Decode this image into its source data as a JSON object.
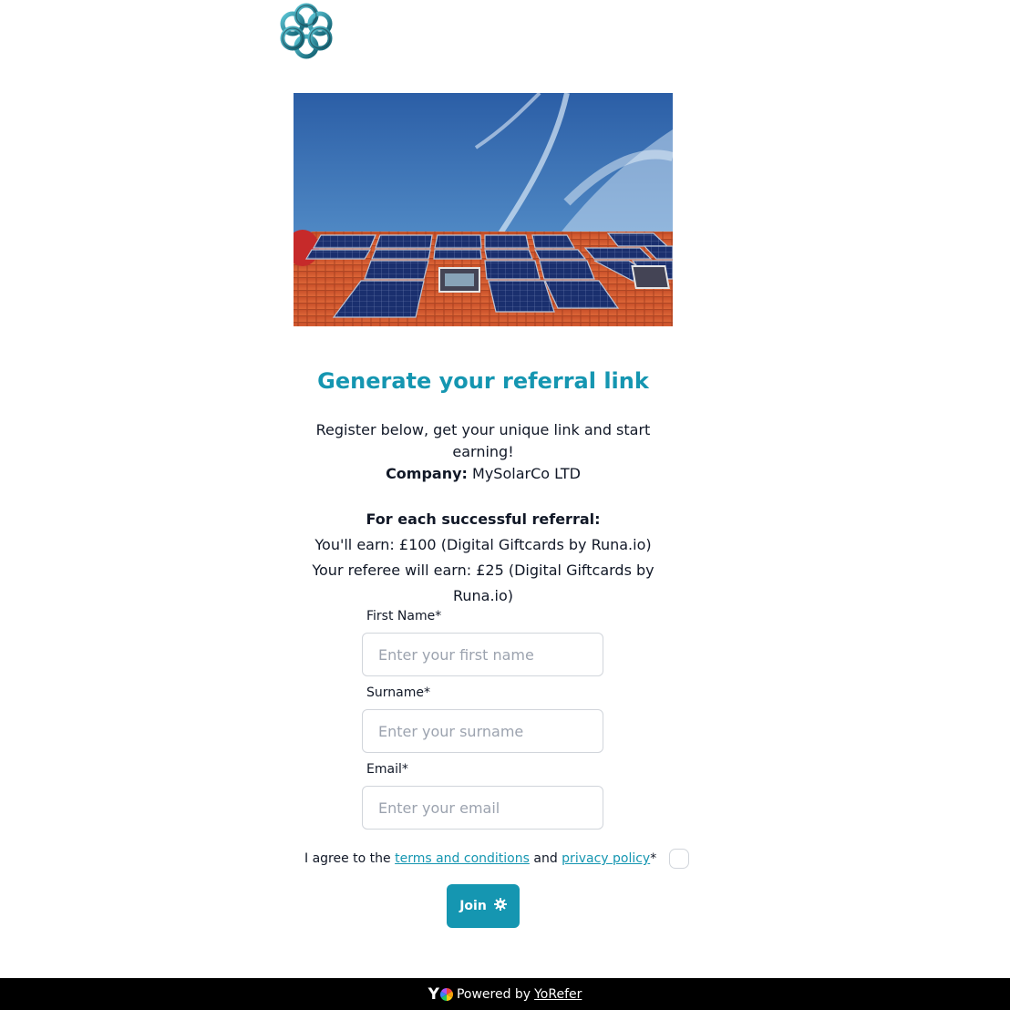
{
  "brand": {
    "logo_icon": "knot-logo-icon",
    "accent_color": "#1596b1"
  },
  "hero": {
    "image_icon": "solar-panels-roof-photo"
  },
  "heading": {
    "title": "Generate your referral link",
    "subtitle": "Register below, get your unique link and start earning!"
  },
  "company": {
    "label": "Company:",
    "name": "MySolarCo LTD"
  },
  "rewards": {
    "heading": "For each successful referral:",
    "you_earn": "You'll earn: £100 (Digital Giftcards by Runa.io)",
    "referee_earns": "Your referee will earn: £25 (Digital Giftcards by Runa.io)"
  },
  "form": {
    "first_name": {
      "label": "First Name*",
      "placeholder": "Enter your first name",
      "value": ""
    },
    "surname": {
      "label": "Surname*",
      "placeholder": "Enter your surname",
      "value": ""
    },
    "email": {
      "label": "Email*",
      "placeholder": "Enter your email",
      "value": ""
    },
    "agree": {
      "prefix": "I agree to the",
      "terms_link": "terms and conditions",
      "middle": "and",
      "privacy_link": "privacy policy",
      "suffix": "*",
      "checked": false
    },
    "submit_label": "Join",
    "submit_icon": "gear-icon"
  },
  "footer": {
    "logo_text": "Y",
    "logo_icon": "yorefer-logo-icon",
    "powered_by": "Powered by",
    "brand_link": "YoRefer"
  }
}
